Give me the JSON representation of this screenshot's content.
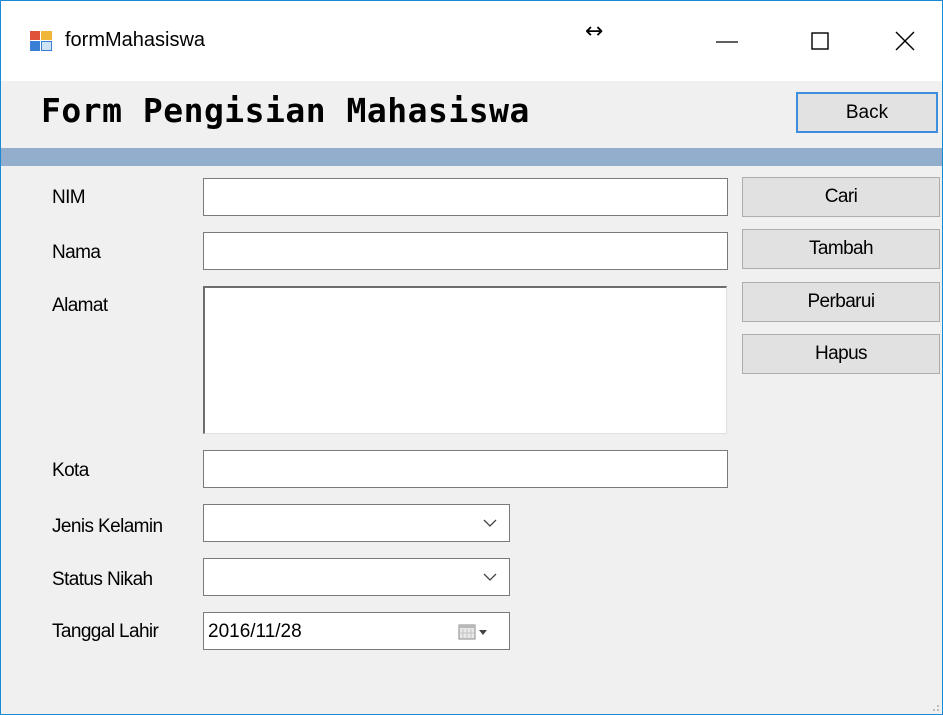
{
  "window": {
    "title": "formMahasiswa",
    "controls": [
      "minimize-icon",
      "maximize-icon",
      "close-icon"
    ]
  },
  "header": {
    "title": "Form Pengisian Mahasiswa",
    "back_label": "Back"
  },
  "form": {
    "nim_label": "NIM",
    "nama_label": "Nama",
    "alamat_label": "Alamat",
    "kota_label": "Kota",
    "jenis_kelamin_label": "Jenis Kelamin",
    "status_nikah_label": "Status Nikah",
    "tanggal_lahir_label": "Tanggal Lahir",
    "nim_value": "",
    "nama_value": "",
    "alamat_value": "",
    "kota_value": "",
    "jenis_kelamin_value": "",
    "status_nikah_value": "",
    "tanggal_lahir_value": "2016/11/28"
  },
  "actions": {
    "cari_label": "Cari",
    "tambah_label": "Tambah",
    "perbarui_label": "Perbarui",
    "hapus_label": "Hapus"
  },
  "colors": {
    "accent": "#1a8ad4",
    "bar": "#93aecd",
    "background": "#f0f0f0"
  }
}
